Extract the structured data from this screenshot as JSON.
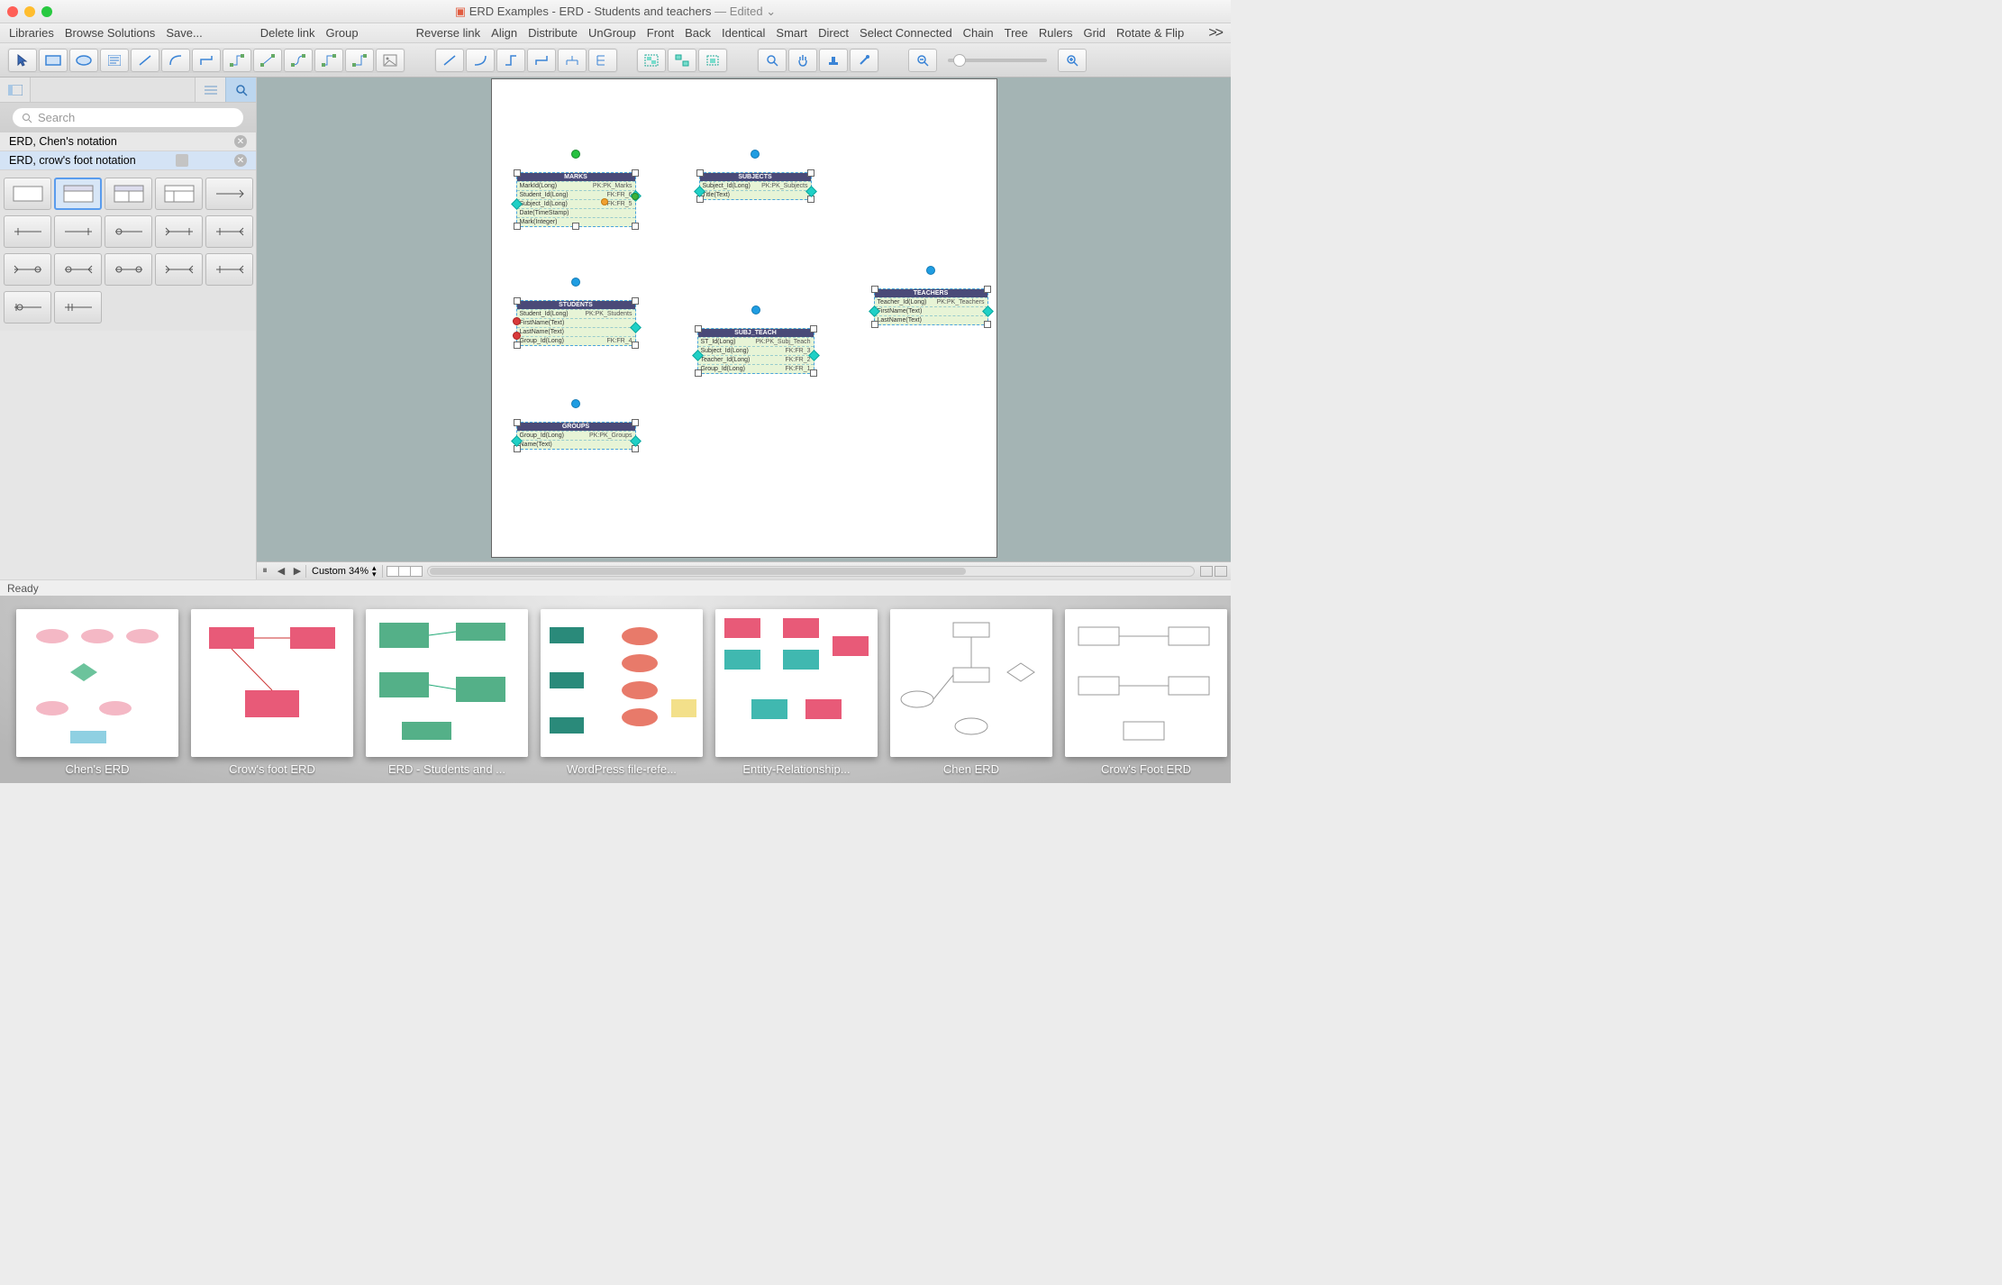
{
  "window": {
    "title_prefix": "ERD Examples - ERD - Students and teachers",
    "edited_suffix": "— Edited"
  },
  "menu": {
    "items": [
      "Libraries",
      "Browse Solutions",
      "Save...",
      "Delete link",
      "Group",
      "Reverse link",
      "Align",
      "Distribute",
      "UnGroup",
      "Front",
      "Back",
      "Identical",
      "Smart",
      "Direct",
      "Select Connected",
      "Chain",
      "Tree",
      "Rulers",
      "Grid",
      "Rotate & Flip"
    ],
    "more": ">>"
  },
  "sidebar": {
    "search_placeholder": "Search",
    "libs": {
      "chen": "ERD, Chen's notation",
      "crows": "ERD, crow's foot notation"
    }
  },
  "canvas": {
    "zoom_label": "Custom 34%"
  },
  "status": {
    "text": "Ready"
  },
  "entities": {
    "marks": {
      "title": "MARKS",
      "rows": [
        [
          "MarkId(Long)",
          "PK:PK_Marks"
        ],
        [
          "Student_Id(Long)",
          "FK:FR_6"
        ],
        [
          "Subject_Id(Long)",
          "FK:FR_5"
        ],
        [
          "Date(TimeStamp)",
          ""
        ],
        [
          "Mark(Integer)",
          ""
        ]
      ]
    },
    "subjects": {
      "title": "SUBJECTS",
      "rows": [
        [
          "Subject_Id(Long)",
          "PK:PK_Subjects"
        ],
        [
          "Title(Text)",
          ""
        ]
      ]
    },
    "students": {
      "title": "STUDENTS",
      "rows": [
        [
          "Student_Id(Long)",
          "PK:PK_Students"
        ],
        [
          "FirstName(Text)",
          ""
        ],
        [
          "LastName(Text)",
          ""
        ],
        [
          "Group_Id(Long)",
          "FK:FR_4"
        ]
      ]
    },
    "teachers": {
      "title": "TEACHERS",
      "rows": [
        [
          "Teacher_Id(Long)",
          "PK:PK_Teachers"
        ],
        [
          "FirstName(Text)",
          ""
        ],
        [
          "LastName(Text)",
          ""
        ]
      ]
    },
    "subjteach": {
      "title": "SUBJ_TEACH",
      "rows": [
        [
          "ST_Id(Long)",
          "PK:PK_Subj_Teach"
        ],
        [
          "Subject_Id(Long)",
          "FK:FR_3"
        ],
        [
          "Teacher_Id(Long)",
          "FK:FR_2"
        ],
        [
          "Group_Id(Long)",
          "FK:FR_1"
        ]
      ]
    },
    "groups": {
      "title": "GROUPS",
      "rows": [
        [
          "Group_Id(Long)",
          "PK:PK_Groups"
        ],
        [
          "Name(Text)",
          ""
        ]
      ]
    }
  },
  "gallery": {
    "items": [
      "Chen's ERD",
      "Crow's foot ERD",
      "ERD - Students and ...",
      "WordPress file-refe...",
      "Entity-Relationship...",
      "Chen ERD",
      "Crow's Foot ERD"
    ]
  }
}
